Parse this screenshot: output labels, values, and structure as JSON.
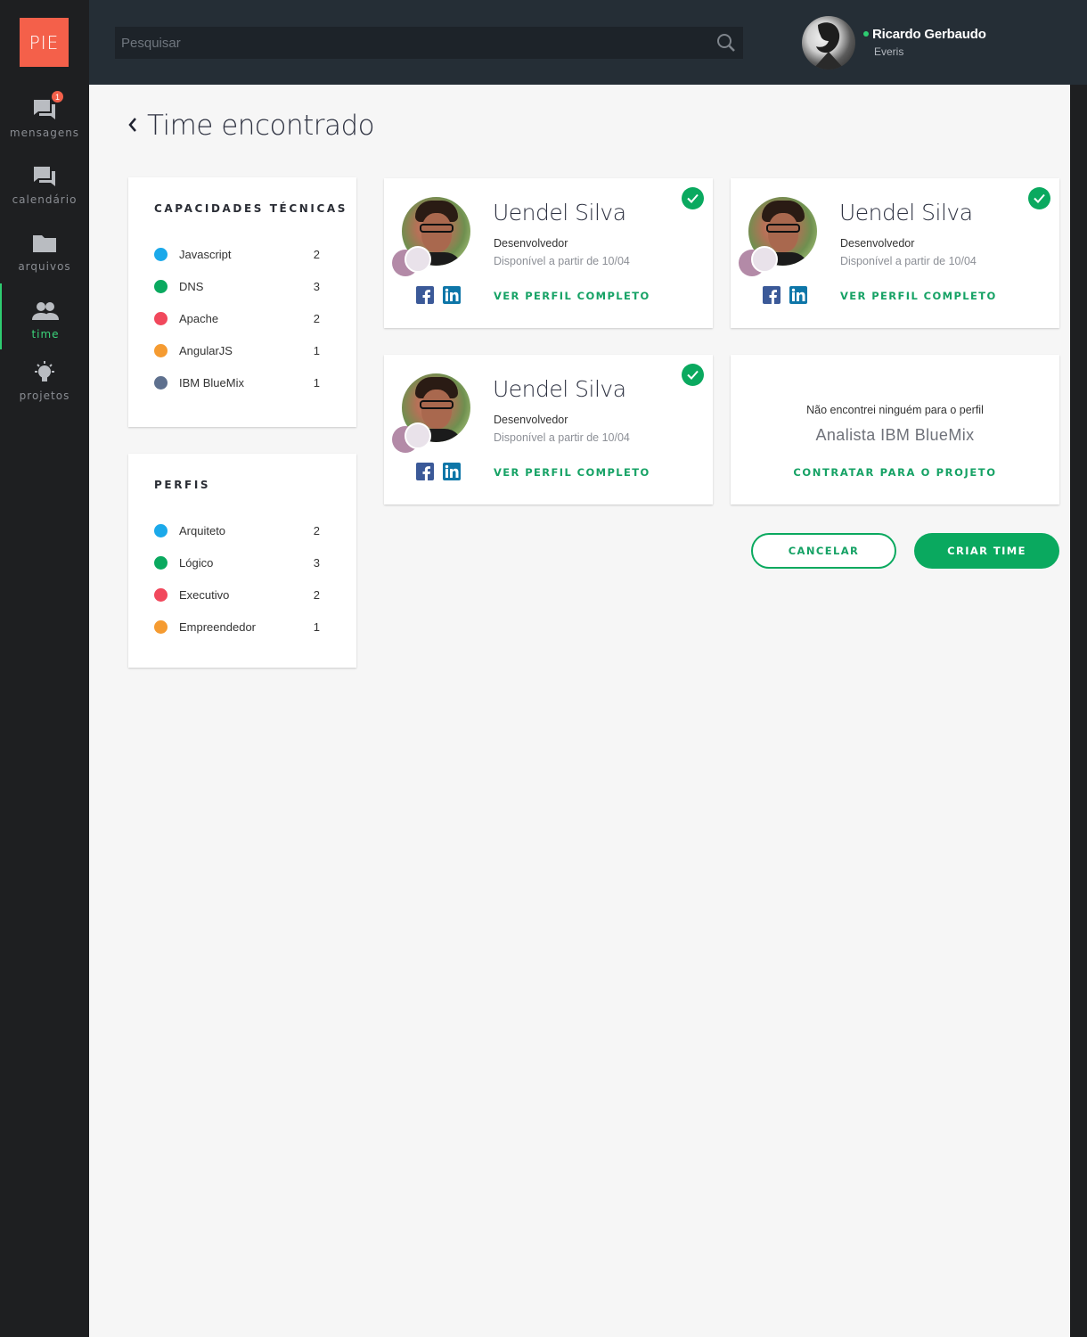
{
  "app": {
    "logo": "PIE"
  },
  "sidebar": {
    "items": [
      {
        "label": "mensagens",
        "icon": "chat-icon",
        "badge": "1"
      },
      {
        "label": "calendário",
        "icon": "chat-icon"
      },
      {
        "label": "arquivos",
        "icon": "folder-icon"
      },
      {
        "label": "time",
        "icon": "people-icon",
        "active": true
      },
      {
        "label": "projetos",
        "icon": "lightbulb-icon"
      }
    ]
  },
  "topbar": {
    "search_placeholder": "Pesquisar",
    "user": {
      "name": "Ricardo Gerbaudo",
      "company": "Everis",
      "status": "online"
    }
  },
  "page": {
    "title": "Time encontrado"
  },
  "skills_panel": {
    "title": "CAPACIDADES TÉCNICAS",
    "items": [
      {
        "label": "Javascript",
        "count": "2",
        "color": "#1ba9ea"
      },
      {
        "label": "DNS",
        "count": "3",
        "color": "#0aa95f"
      },
      {
        "label": "Apache",
        "count": "2",
        "color": "#f1485c"
      },
      {
        "label": "AngularJS",
        "count": "1",
        "color": "#f59b31"
      },
      {
        "label": "IBM BlueMix",
        "count": "1",
        "color": "#5e708e"
      }
    ]
  },
  "profiles_panel": {
    "title": "PERFIS",
    "items": [
      {
        "label": "Arquiteto",
        "count": "2",
        "color": "#1ba9ea"
      },
      {
        "label": "Lógico",
        "count": "3",
        "color": "#0aa95f"
      },
      {
        "label": "Executivo",
        "count": "2",
        "color": "#f1485c"
      },
      {
        "label": "Empreendedor",
        "count": "1",
        "color": "#f59b31"
      }
    ]
  },
  "cards": [
    {
      "name": "Uendel Silva",
      "role": "Desenvolvedor",
      "availability": "Disponível a partir de 10/04",
      "link": "VER PERFIL COMPLETO"
    },
    {
      "name": "Uendel Silva",
      "role": "Desenvolvedor",
      "availability": "Disponível a partir de 10/04",
      "link": "VER PERFIL COMPLETO"
    },
    {
      "name": "Uendel Silva",
      "role": "Desenvolvedor",
      "availability": "Disponível a partir de 10/04",
      "link": "VER PERFIL COMPLETO"
    }
  ],
  "empty_card": {
    "message": "Não encontrei ninguém para o perfil",
    "role": "Analista IBM BlueMix",
    "action": "CONTRATAR PARA O PROJETO"
  },
  "actions": {
    "cancel": "CANCELAR",
    "create": "CRIAR TIME"
  },
  "colors": {
    "accent": "#0aa95f",
    "logo": "#f4604a",
    "topbar": "#252e36",
    "sidebar": "#1e1f21"
  }
}
